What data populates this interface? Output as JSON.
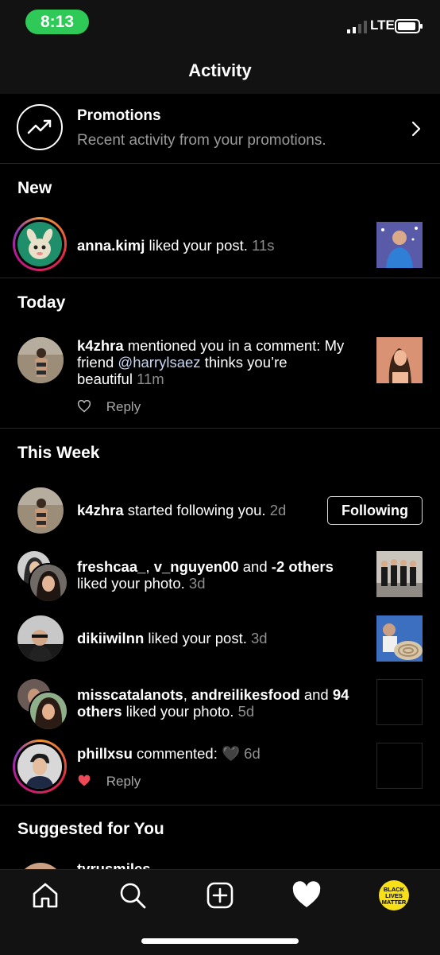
{
  "status_bar": {
    "time": "8:13",
    "network": "LTE"
  },
  "header": {
    "title": "Activity"
  },
  "promotions": {
    "title": "Promotions",
    "subtitle": "Recent activity from your promotions."
  },
  "sections": {
    "new": "New",
    "today": "Today",
    "this_week": "This Week",
    "suggested": "Suggested for You"
  },
  "items": {
    "anna": {
      "user": "anna.kimj",
      "action": " liked your post.",
      "time": " 11s"
    },
    "k4zhra_mention": {
      "user": "k4zhra",
      "action_1": " mentioned you in a comment: My",
      "action_2a": "friend ",
      "mention": "@harrylsaez",
      "action_2b": " thinks you’re",
      "action_3": "beautiful",
      "time": " 11m",
      "reply": "Reply"
    },
    "k4zhra_follow": {
      "user": "k4zhra",
      "action": " started following you.",
      "time": " 2d",
      "button": "Following"
    },
    "freshcaa": {
      "user1": "freshcaa_",
      "sep": ", ",
      "user2": "v_nguyen00",
      "and": " and ",
      "others": "-2 others",
      "action": "liked your photo.",
      "time": " 3d"
    },
    "dikii": {
      "user": "dikiiwilnn",
      "action": " liked your post.",
      "time": " 3d"
    },
    "misscata": {
      "user1": "misscatalanots",
      "sep": ", ",
      "user2": "andreilikesfood",
      "and": " and ",
      "count": "94",
      "others_word": "others",
      "action": " liked your photo.",
      "time": " 5d"
    },
    "phillxsu": {
      "user": "phillxsu",
      "action": " commented: ",
      "emoji": "🖤",
      "time": " 6d",
      "reply": "Reply"
    },
    "tyrus": {
      "user": "tyrusmiles"
    }
  },
  "tabs": [
    "home-icon",
    "search-icon",
    "new-post-icon",
    "activity-heart-icon",
    "profile-avatar"
  ],
  "profile_badge": {
    "line1": "BLACK",
    "line2": "LIVES",
    "line3": "MATTER"
  },
  "colors": {
    "accent_green": "#2ec956",
    "heart_red": "#ed4956",
    "muted": "#8e8e8e"
  }
}
